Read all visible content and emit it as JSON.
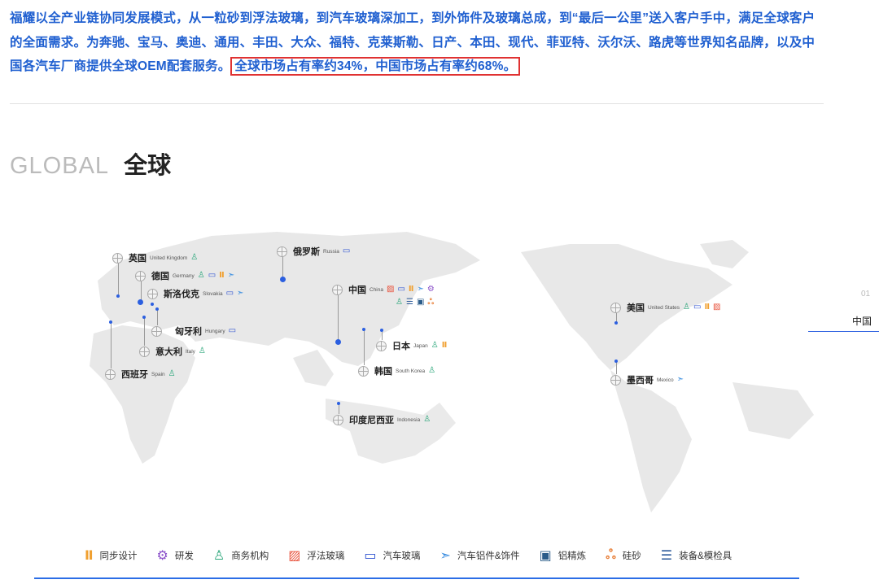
{
  "intro": {
    "text": "福耀以全产业链协同发展模式，从一粒砂到浮法玻璃，到汽车玻璃深加工，到外饰件及玻璃总成，到“最后一公里”送入客户手中，满足全球客户的全面需求。为奔驰、宝马、奥迪、通用、丰田、大众、福特、克莱斯勒、日产、本田、现代、菲亚特、沃尔沃、路虎等世界知名品牌，以及中国各汽车厂商提供全球OEM配套服务。",
    "highlight": "全球市场占有率约34%，中国市场占有率约68%。"
  },
  "section": {
    "title_en": "GLOBAL",
    "title_cn": "全球"
  },
  "markers": [
    {
      "cn": "英国",
      "en": "United Kingdom",
      "icons": [
        "business"
      ]
    },
    {
      "cn": "俄罗斯",
      "en": "Russia",
      "icons": [
        "auto-glass"
      ]
    },
    {
      "cn": "德国",
      "en": "Germany",
      "icons": [
        "business",
        "auto-glass",
        "sync-design",
        "aluminum-parts"
      ]
    },
    {
      "cn": "斯洛伐克",
      "en": "Slovakia",
      "icons": [
        "auto-glass",
        "aluminum-parts"
      ]
    },
    {
      "cn": "匈牙利",
      "en": "Hungary",
      "icons": [
        "auto-glass"
      ]
    },
    {
      "cn": "意大利",
      "en": "Italy",
      "icons": [
        "business"
      ]
    },
    {
      "cn": "西班牙",
      "en": "Spain",
      "icons": [
        "business"
      ]
    },
    {
      "cn": "中国",
      "en": "China",
      "icons": [
        "float-glass",
        "auto-glass",
        "sync-design",
        "aluminum-parts",
        "rnd",
        "business",
        "equipment",
        "aluminum-refining",
        "silica"
      ]
    },
    {
      "cn": "日本",
      "en": "Japan",
      "icons": [
        "business",
        "sync-design"
      ]
    },
    {
      "cn": "韩国",
      "en": "South Korea",
      "icons": [
        "business"
      ]
    },
    {
      "cn": "印度尼西亚",
      "en": "Indonesia",
      "icons": [
        "business"
      ]
    },
    {
      "cn": "美国",
      "en": "United States",
      "icons": [
        "business",
        "auto-glass",
        "sync-design",
        "float-glass"
      ]
    },
    {
      "cn": "墨西哥",
      "en": "Mexico",
      "icons": [
        "aluminum-parts"
      ]
    }
  ],
  "side_nav": {
    "number": "01",
    "label": "中国"
  },
  "legend": [
    {
      "icon": "sync-design",
      "label": "同步设计",
      "color": "#f0a030"
    },
    {
      "icon": "rnd",
      "label": "研发",
      "color": "#8a4fc9"
    },
    {
      "icon": "business",
      "label": "商务机构",
      "color": "#2aa67a"
    },
    {
      "icon": "float-glass",
      "label": "浮法玻璃",
      "color": "#e8503a"
    },
    {
      "icon": "auto-glass",
      "label": "汽车玻璃",
      "color": "#2b4fd0"
    },
    {
      "icon": "aluminum-parts",
      "label": "汽车铝件&饰件",
      "color": "#3a8de0"
    },
    {
      "icon": "aluminum-refining",
      "label": "铝精炼",
      "color": "#2a5c8a"
    },
    {
      "icon": "silica",
      "label": "硅砂",
      "color": "#e8803a"
    },
    {
      "icon": "equipment",
      "label": "装备&模检具",
      "color": "#2b5a9a"
    }
  ]
}
